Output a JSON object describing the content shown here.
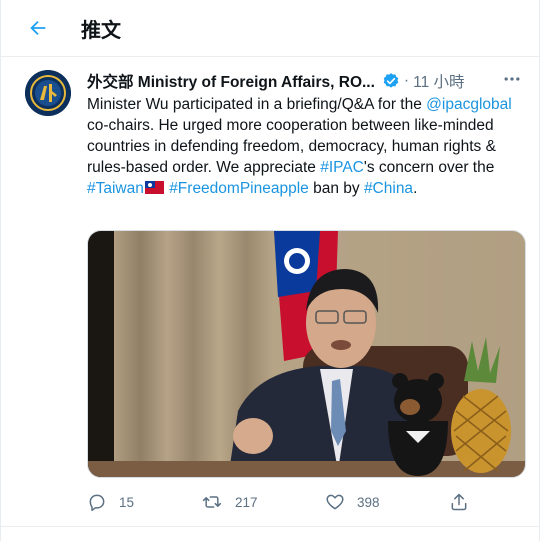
{
  "header": {
    "title": "推文"
  },
  "tweet": {
    "author_name": "外交部 Ministry of Foreign Affairs, RO...",
    "separator": "·",
    "time": "11 小時",
    "text": {
      "p1": "Minister Wu participated in a briefing/Q&A for the ",
      "mention": "@ipacglobal",
      "p2": " co-chairs. He urged more cooperation between like-minded countries in defending freedom, democracy, human rights & rules-based order. We appreciate ",
      "tag1": "#IPAC",
      "p3": "'s concern over the ",
      "tag2": "#Taiwan",
      "p4": " ",
      "tag3": "#FreedomPineapple",
      "p5": " ban by ",
      "tag4": "#China",
      "p6": "."
    }
  },
  "actions": {
    "reply_count": "15",
    "retweet_count": "217",
    "like_count": "398"
  },
  "colors": {
    "accent": "#1da1f2",
    "link": "#1b95e0",
    "muted": "#5b7083"
  }
}
